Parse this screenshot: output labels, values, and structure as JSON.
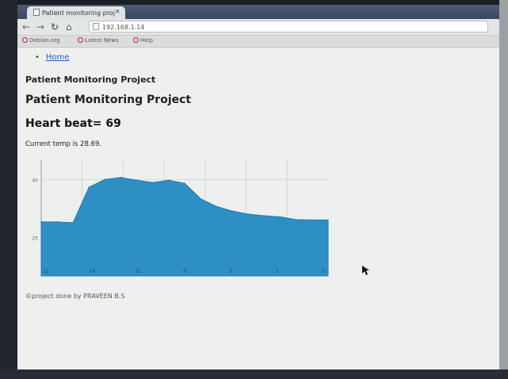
{
  "browser": {
    "tab_title": "Patient monitoring proj",
    "tab_close": "×",
    "url": "192.168.1.14",
    "bookmarks": [
      "Debian.org",
      "Latest News",
      "Help"
    ]
  },
  "page": {
    "nav": {
      "home_label": "Home"
    },
    "heading_small": "Patient Monitoring Project",
    "heading_mid": "Patient Monitoring Project",
    "heartbeat_text": "Heart beat= 69",
    "temp_text": "Current temp is 28.69.",
    "footer": "©project done by PRAVEEN B.S"
  },
  "chart_data": {
    "type": "area",
    "title": "",
    "xlabel": "",
    "ylabel": "",
    "ylim": [
      15,
      45
    ],
    "yticks": [
      25,
      40
    ],
    "x_tick_labels": [
      "13",
      "14",
      "15",
      "6",
      "1",
      "2",
      "3"
    ],
    "x": [
      0,
      1,
      2,
      3,
      4,
      5,
      6,
      7,
      8,
      9,
      10,
      11,
      12,
      13,
      14,
      15,
      16,
      17,
      18
    ],
    "values": [
      29,
      29,
      28.8,
      38,
      40,
      40.5,
      39.8,
      39.2,
      39.8,
      39,
      35,
      33,
      31.8,
      31,
      30.6,
      30.3,
      29.6,
      29.5,
      29.5
    ],
    "grid": true,
    "fill_color": "#2e8fc4"
  }
}
